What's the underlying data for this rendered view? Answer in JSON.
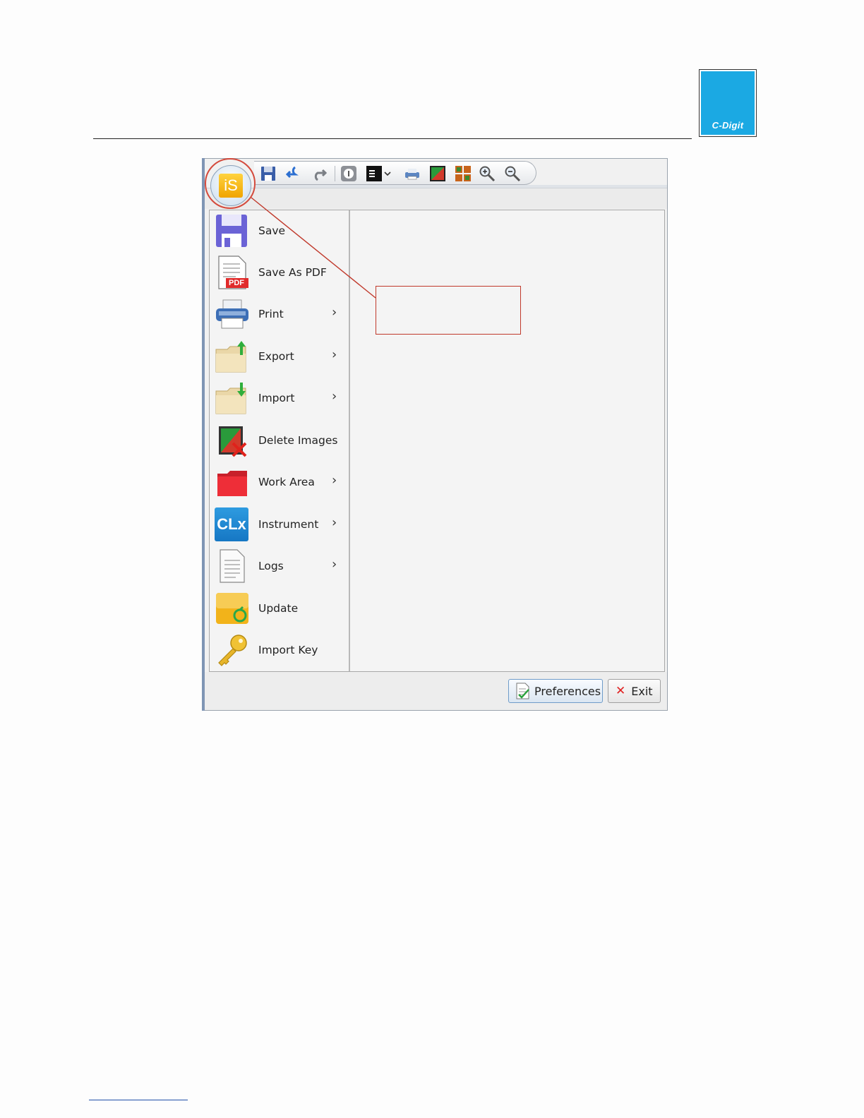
{
  "logo": {
    "text": "C-Digit"
  },
  "toolbar": {
    "icons": [
      "save-icon",
      "undo-icon",
      "redo-icon",
      "info-icon",
      "display-icon",
      "chevron-down-icon",
      "print-icon",
      "image-icon",
      "grid-icon",
      "zoom-in-icon",
      "zoom-out-icon"
    ]
  },
  "app_button": {
    "logo_text": "iS"
  },
  "menu": {
    "items": [
      {
        "label": "Save",
        "icon": "save-icon",
        "submenu": false
      },
      {
        "label": "Save As PDF",
        "icon": "pdf-icon",
        "submenu": false
      },
      {
        "label": "Print",
        "icon": "printer-icon",
        "submenu": true
      },
      {
        "label": "Export",
        "icon": "folder-export-icon",
        "submenu": true
      },
      {
        "label": "Import",
        "icon": "folder-import-icon",
        "submenu": true
      },
      {
        "label": "Delete Images",
        "icon": "delete-image-icon",
        "submenu": false
      },
      {
        "label": "Work Area",
        "icon": "folder-red-icon",
        "submenu": true
      },
      {
        "label": "Instrument",
        "icon": "instrument-clx-icon",
        "submenu": true
      },
      {
        "label": "Logs",
        "icon": "document-icon",
        "submenu": true
      },
      {
        "label": "Update",
        "icon": "update-icon",
        "submenu": false
      },
      {
        "label": "Import Key",
        "icon": "key-icon",
        "submenu": false
      }
    ],
    "instrument_icon_text": "CLx",
    "pdf_badge": "PDF",
    "chevron": "›"
  },
  "footer": {
    "preferences_label": "Preferences",
    "exit_label": "Exit",
    "exit_glyph": "✕"
  },
  "colors": {
    "accent": "#1ba9e3",
    "annotation": "#c0392b",
    "app_logo": "#f5b400"
  }
}
